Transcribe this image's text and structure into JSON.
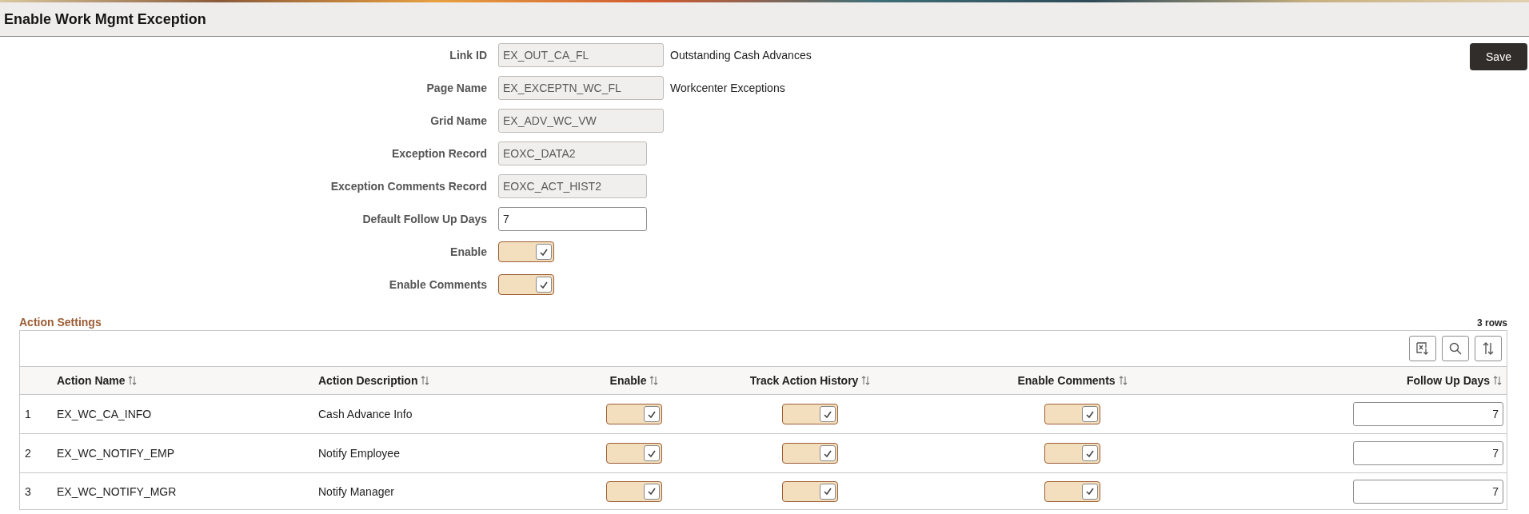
{
  "page": {
    "title": "Enable Work Mgmt Exception"
  },
  "save_button": "Save",
  "form": {
    "fields": [
      {
        "kind": "readonly",
        "label": "Link ID",
        "value": "EX_OUT_CA_FL",
        "description": "Outstanding Cash Advances"
      },
      {
        "kind": "readonly",
        "label": "Page Name",
        "value": "EX_EXCEPTN_WC_FL",
        "description": "Workcenter Exceptions"
      },
      {
        "kind": "readonly",
        "label": "Grid Name",
        "value": "EX_ADV_WC_VW"
      },
      {
        "kind": "readonly",
        "label": "Exception Record",
        "value": "EOXC_DATA2"
      },
      {
        "kind": "readonly",
        "label": "Exception Comments Record",
        "value": "EOXC_ACT_HIST2"
      },
      {
        "kind": "input",
        "label": "Default Follow Up Days",
        "value": "7"
      },
      {
        "kind": "toggle",
        "label": "Enable",
        "checked": true
      },
      {
        "kind": "toggle",
        "label": "Enable Comments",
        "checked": true
      }
    ]
  },
  "action_settings": {
    "title": "Action Settings",
    "row_count": "3 rows",
    "columns": [
      "Action Name",
      "Action Description",
      "Enable",
      "Track Action History",
      "Enable Comments",
      "Follow Up Days"
    ],
    "rows": [
      {
        "number": "1",
        "action_name": "EX_WC_CA_INFO",
        "action_description": "Cash Advance Info",
        "enable": true,
        "track_action_history": true,
        "enable_comments": true,
        "follow_up_days": "7"
      },
      {
        "number": "2",
        "action_name": "EX_WC_NOTIFY_EMP",
        "action_description": "Notify Employee",
        "enable": true,
        "track_action_history": true,
        "enable_comments": true,
        "follow_up_days": "7"
      },
      {
        "number": "3",
        "action_name": "EX_WC_NOTIFY_MGR",
        "action_description": "Notify Manager",
        "enable": true,
        "track_action_history": true,
        "enable_comments": true,
        "follow_up_days": "7"
      }
    ]
  }
}
